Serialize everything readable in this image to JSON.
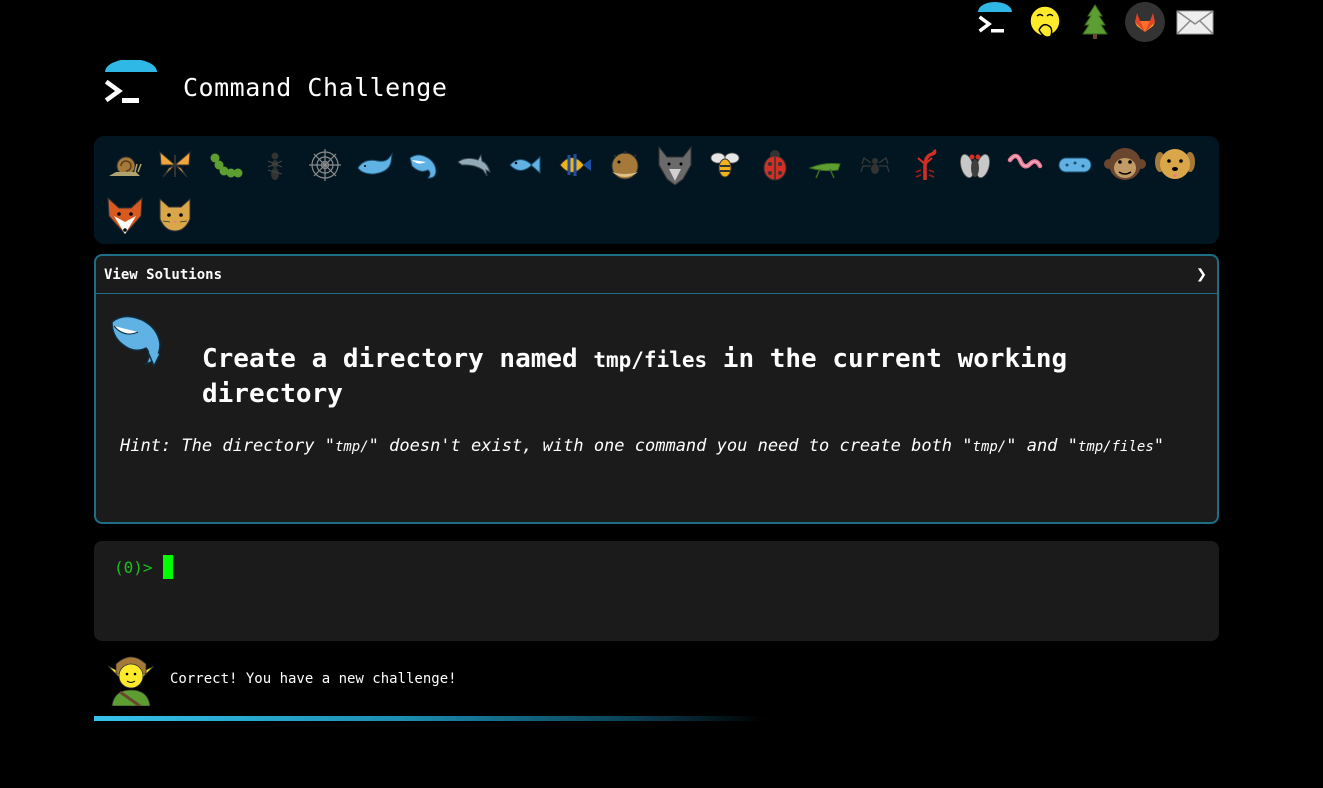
{
  "app": {
    "title": "Command Challenge"
  },
  "top_icons": [
    "terminal-logo-icon",
    "hand-over-mouth-face-icon",
    "evergreen-tree-icon",
    "gitlab-fox-icon",
    "envelope-icon"
  ],
  "critters": [
    "snail-icon",
    "butterfly-icon",
    "caterpillar-icon",
    "ant-icon",
    "spider-web-icon",
    "whale-icon",
    "spouting-whale-icon",
    "dolphin-icon",
    "fish-icon",
    "tropical-fish-icon",
    "blowfish-icon",
    "wolf-icon",
    "bee-icon",
    "ladybug-icon",
    "cricket-icon",
    "spider-icon",
    "scorpion-icon",
    "fly-icon",
    "worm-icon",
    "microbe-icon",
    "monkey-icon",
    "dog-icon",
    "fox-icon",
    "cat-icon"
  ],
  "solutions": {
    "label": "View Solutions",
    "chevron": "❯"
  },
  "challenge": {
    "icon": "spouting-whale-icon",
    "text_before": "Create a directory named ",
    "code": "tmp/files",
    "text_after": " in the current working directory",
    "hint": {
      "prefix": "Hint: The directory \"",
      "code1": "tmp/",
      "mid1": "\" doesn't exist, with one command you need to create both \"",
      "code2": "tmp/",
      "mid2": "\" and \"",
      "code3": "tmp/files",
      "suffix": "\""
    }
  },
  "terminal": {
    "prompt": "(0)>",
    "value": ""
  },
  "feedback": {
    "avatar": "elf-icon",
    "message": "Correct! You have a new challenge!"
  },
  "progress": {
    "fraction": 0.5
  },
  "colors": {
    "accent": "#35c3ec",
    "border": "#1d6f86",
    "prompt": "#1bbf1b",
    "cursor": "#00ff00",
    "panel": "#021621"
  }
}
